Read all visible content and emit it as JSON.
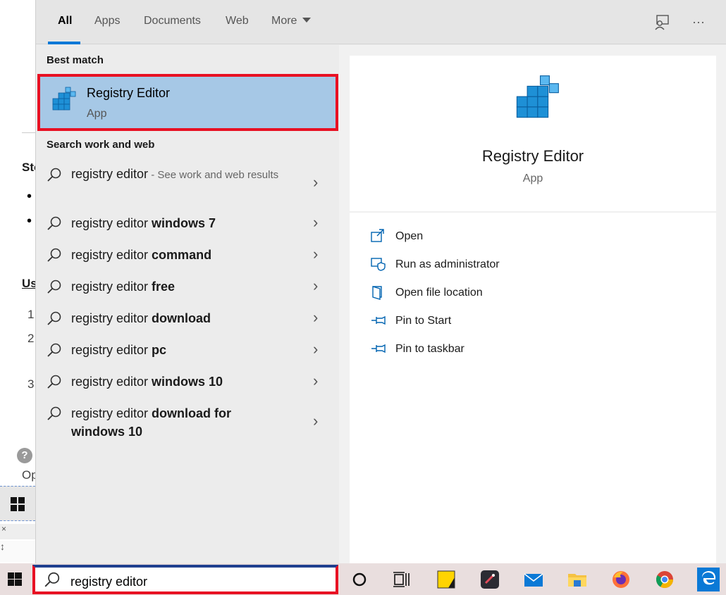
{
  "background_page": {
    "frag1": "Sto",
    "bullet1": "•",
    "bullet2": "•",
    "frag2": "Us",
    "num1": "1",
    "num2": "2",
    "num3": "3",
    "help_glyph": "?",
    "frag3": "Op",
    "glyph1": "×",
    "glyph2": "↕"
  },
  "tabs": [
    {
      "label": "All",
      "active": true
    },
    {
      "label": "Apps"
    },
    {
      "label": "Documents"
    },
    {
      "label": "Web"
    },
    {
      "label": "More"
    }
  ],
  "toolbar": {
    "feedback_icon": "feedback-icon",
    "more_icon": "ellipsis-icon",
    "more_glyph": "···"
  },
  "best_match": {
    "section_label": "Best match",
    "name": "Registry Editor",
    "type": "App",
    "icon": "registry-editor-icon"
  },
  "search_web": {
    "section_label": "Search work and web",
    "items": [
      {
        "prefix": "registry editor",
        "bold": "",
        "suffix": " - See work and web results"
      },
      {
        "prefix": "registry editor ",
        "bold": "windows 7",
        "suffix": ""
      },
      {
        "prefix": "registry editor ",
        "bold": "command",
        "suffix": ""
      },
      {
        "prefix": "registry editor ",
        "bold": "free",
        "suffix": ""
      },
      {
        "prefix": "registry editor ",
        "bold": "download",
        "suffix": ""
      },
      {
        "prefix": "registry editor ",
        "bold": "pc",
        "suffix": ""
      },
      {
        "prefix": "registry editor ",
        "bold": "windows 10",
        "suffix": ""
      },
      {
        "prefix": "registry editor ",
        "bold": "download for windows 10",
        "suffix": ""
      }
    ],
    "chevron": "›"
  },
  "preview": {
    "title": "Registry Editor",
    "subtitle": "App",
    "actions": [
      {
        "label": "Open",
        "icon": "open-icon"
      },
      {
        "label": "Run as administrator",
        "icon": "shield-icon"
      },
      {
        "label": "Open file location",
        "icon": "file-location-icon"
      },
      {
        "label": "Pin to Start",
        "icon": "pin-icon"
      },
      {
        "label": "Pin to taskbar",
        "icon": "pin-icon"
      }
    ]
  },
  "taskbar": {
    "search_value": "registry editor",
    "icons": [
      "cortana-icon",
      "task-view-icon",
      "sticky-notes-icon",
      "app-icon",
      "mail-icon",
      "file-explorer-icon",
      "firefox-icon",
      "chrome-icon",
      "edge-icon"
    ]
  },
  "colors": {
    "accent": "#0078d7",
    "highlight": "#a6c8e6",
    "annotation_red": "#e81123"
  }
}
